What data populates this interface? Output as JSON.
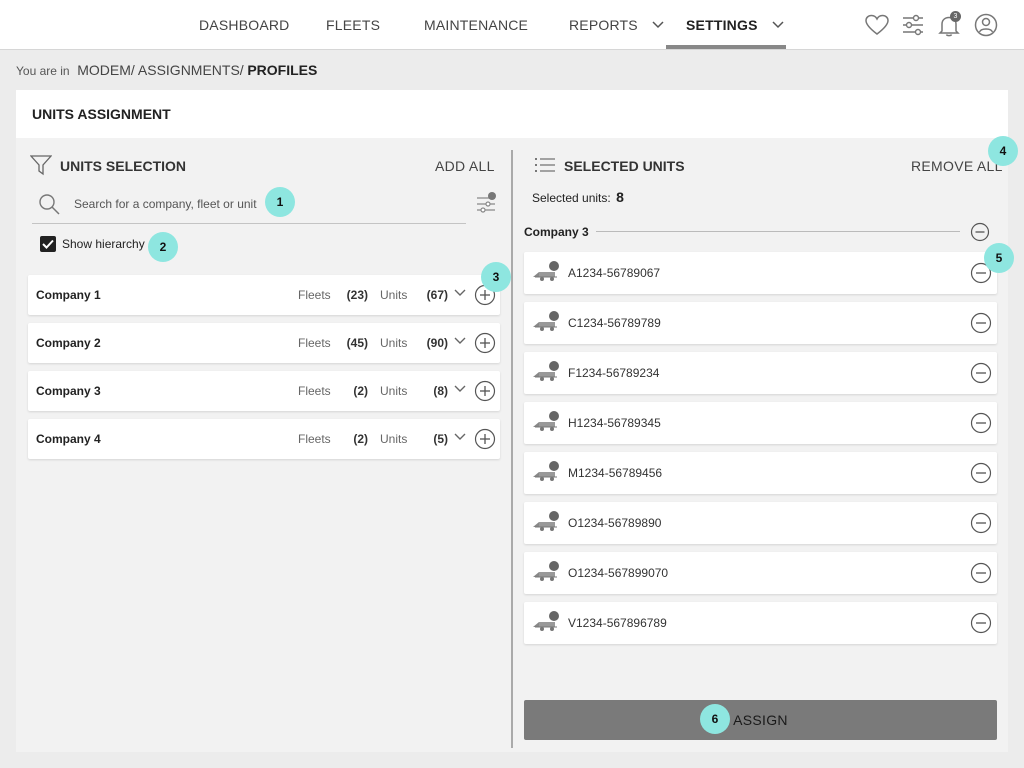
{
  "nav": {
    "items": [
      {
        "label": "DASHBOARD"
      },
      {
        "label": "FLEETS"
      },
      {
        "label": "MAINTENANCE"
      },
      {
        "label": "REPORTS"
      },
      {
        "label": "SETTINGS"
      }
    ],
    "active": "SETTINGS",
    "notification_count": "3",
    "icons": [
      "heart-icon",
      "sliders-icon",
      "bell-icon",
      "user-icon"
    ]
  },
  "breadcrumb": {
    "prefix": "You are in",
    "path": "MODEM/ ASSIGNMENTS/",
    "current": "PROFILES"
  },
  "page": {
    "title": "UNITS ASSIGNMENT"
  },
  "left_panel": {
    "title": "UNITS SELECTION",
    "action": "ADD ALL",
    "search_placeholder": "Search for a company, fleet or unit",
    "show_hierarchy_label": "Show hierarchy",
    "show_hierarchy_checked": true,
    "fleets_label": "Fleets",
    "units_label": "Units",
    "companies": [
      {
        "name": "Company 1",
        "fleets": "(23)",
        "units": "(67)"
      },
      {
        "name": "Company 2",
        "fleets": "(45)",
        "units": "(90)"
      },
      {
        "name": "Company 3",
        "fleets": "(2)",
        "units": "(8)"
      },
      {
        "name": "Company 4",
        "fleets": "(2)",
        "units": "(5)"
      }
    ]
  },
  "right_panel": {
    "title": "SELECTED UNITS",
    "action": "REMOVE ALL",
    "count_label": "Selected units:",
    "count_value": "8",
    "group": "Company 3",
    "units": [
      {
        "id": "A1234-56789067"
      },
      {
        "id": "C1234-56789789"
      },
      {
        "id": "F1234-56789234"
      },
      {
        "id": "H1234-56789345"
      },
      {
        "id": "M1234-56789456"
      },
      {
        "id": "O1234-56789890"
      },
      {
        "id": "O1234-567899070"
      },
      {
        "id": "V1234-567896789"
      }
    ],
    "assign_label": "ASSIGN"
  },
  "markers": [
    "1",
    "2",
    "3",
    "4",
    "5",
    "6"
  ],
  "colors": {
    "marker": "#8ee6e0",
    "assign_button": "#7a7a7a",
    "nav_active_underline": "#888888"
  }
}
